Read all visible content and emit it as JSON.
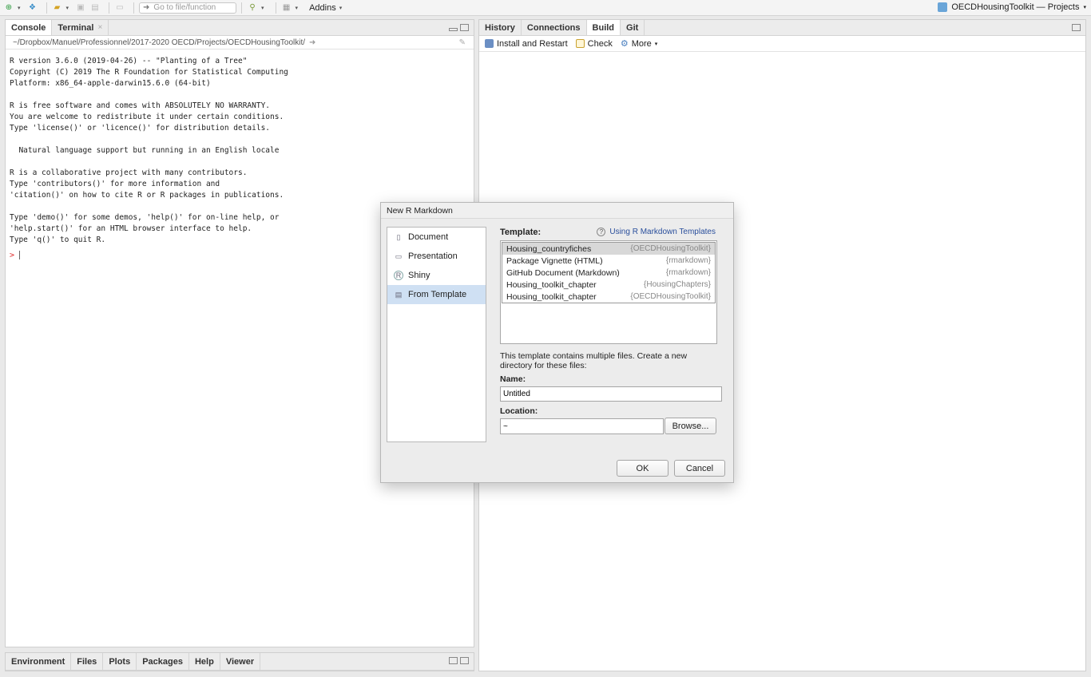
{
  "toolbar": {
    "goto_placeholder": "Go to file/function",
    "addins_label": "Addins",
    "project_label": "OECDHousingToolkit — Projects"
  },
  "console_pane": {
    "tabs": [
      "Console",
      "Terminal"
    ],
    "path": "~/Dropbox/Manuel/Professionnel/2017-2020 OECD/Projects/OECDHousingToolkit/",
    "lines": [
      "R version 3.6.0 (2019-04-26) -- \"Planting of a Tree\"",
      "Copyright (C) 2019 The R Foundation for Statistical Computing",
      "Platform: x86_64-apple-darwin15.6.0 (64-bit)",
      "",
      "R is free software and comes with ABSOLUTELY NO WARRANTY.",
      "You are welcome to redistribute it under certain conditions.",
      "Type 'license()' or 'licence()' for distribution details.",
      "",
      "  Natural language support but running in an English locale",
      "",
      "R is a collaborative project with many contributors.",
      "Type 'contributors()' for more information and",
      "'citation()' on how to cite R or R packages in publications.",
      "",
      "Type 'demo()' for some demos, 'help()' for on-line help, or",
      "'help.start()' for an HTML browser interface to help.",
      "Type 'q()' to quit R."
    ],
    "prompt": ">"
  },
  "env_pane": {
    "tabs": [
      "Environment",
      "Files",
      "Plots",
      "Packages",
      "Help",
      "Viewer"
    ]
  },
  "build_pane": {
    "tabs": [
      "History",
      "Connections",
      "Build",
      "Git"
    ],
    "active_tab": "Build",
    "install_label": "Install and Restart",
    "check_label": "Check",
    "more_label": "More"
  },
  "dialog": {
    "title": "New R Markdown",
    "types": [
      {
        "label": "Document",
        "icon": "document-icon"
      },
      {
        "label": "Presentation",
        "icon": "presentation-icon"
      },
      {
        "label": "Shiny",
        "icon": "shiny-icon"
      },
      {
        "label": "From Template",
        "icon": "template-icon"
      }
    ],
    "selected_type": "From Template",
    "template_label": "Template:",
    "help_link": "Using R Markdown Templates",
    "templates": [
      {
        "name": "Housing_countryfiches",
        "package": "{OECDHousingToolkit}"
      },
      {
        "name": "Package Vignette (HTML)",
        "package": "{rmarkdown}"
      },
      {
        "name": "GitHub Document (Markdown)",
        "package": "{rmarkdown}"
      },
      {
        "name": "Housing_toolkit_chapter",
        "package": "{HousingChapters}"
      },
      {
        "name": "Housing_toolkit_chapter",
        "package": "{OECDHousingToolkit}"
      }
    ],
    "selected_template": "Housing_countryfiches",
    "multi_note": "This template contains multiple files. Create a new directory for these files:",
    "name_label": "Name:",
    "name_value": "Untitled",
    "location_label": "Location:",
    "location_value": "~",
    "browse_label": "Browse...",
    "ok_label": "OK",
    "cancel_label": "Cancel"
  }
}
